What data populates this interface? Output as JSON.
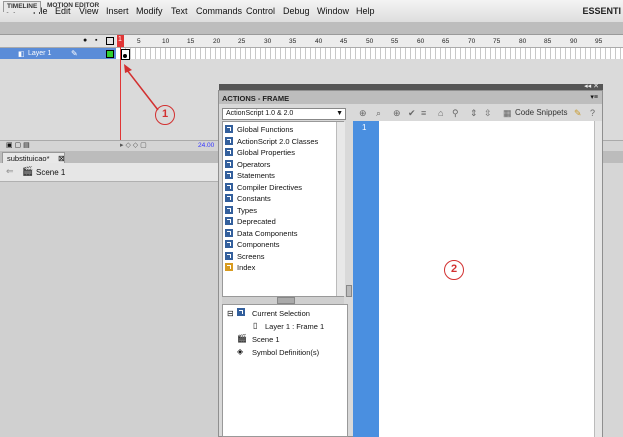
{
  "app": {
    "logo": "Fl",
    "workspace": "ESSENTI"
  },
  "menu": [
    "File",
    "Edit",
    "View",
    "Insert",
    "Modify",
    "Text",
    "Commands",
    "Control",
    "Debug",
    "Window",
    "Help"
  ],
  "timeline": {
    "tabs": [
      "TIMELINE",
      "MOTION EDITOR"
    ],
    "ruler_ticks": [
      "5",
      "10",
      "15",
      "20",
      "25",
      "30",
      "35",
      "40",
      "45",
      "50",
      "55",
      "60",
      "65",
      "70",
      "75",
      "80",
      "85",
      "90",
      "95"
    ],
    "playhead": "1",
    "layer_name": "Layer 1",
    "fps": "24.00"
  },
  "document": {
    "tab": "substituicao*",
    "scene": "Scene 1"
  },
  "actions": {
    "title": "ACTIONS - FRAME",
    "version_select": "ActionScript 1.0 & 2.0",
    "toolbox": [
      "Global Functions",
      "ActionScript 2.0 Classes",
      "Global Properties",
      "Operators",
      "Statements",
      "Compiler Directives",
      "Constants",
      "Types",
      "Deprecated",
      "Data Components",
      "Components",
      "Screens",
      "Index"
    ],
    "tree": {
      "current": "Current Selection",
      "frame": "Layer 1 : Frame 1",
      "scene": "Scene 1",
      "symbols": "Symbol Definition(s)"
    },
    "code_snippets": "Code Snippets",
    "line_number": "1"
  },
  "callouts": [
    "1",
    "2"
  ],
  "colors": {
    "accent": "#4a8fe0",
    "layer_selected": "#5a8cd8",
    "callout": "#d23030",
    "playhead": "#e03535"
  }
}
